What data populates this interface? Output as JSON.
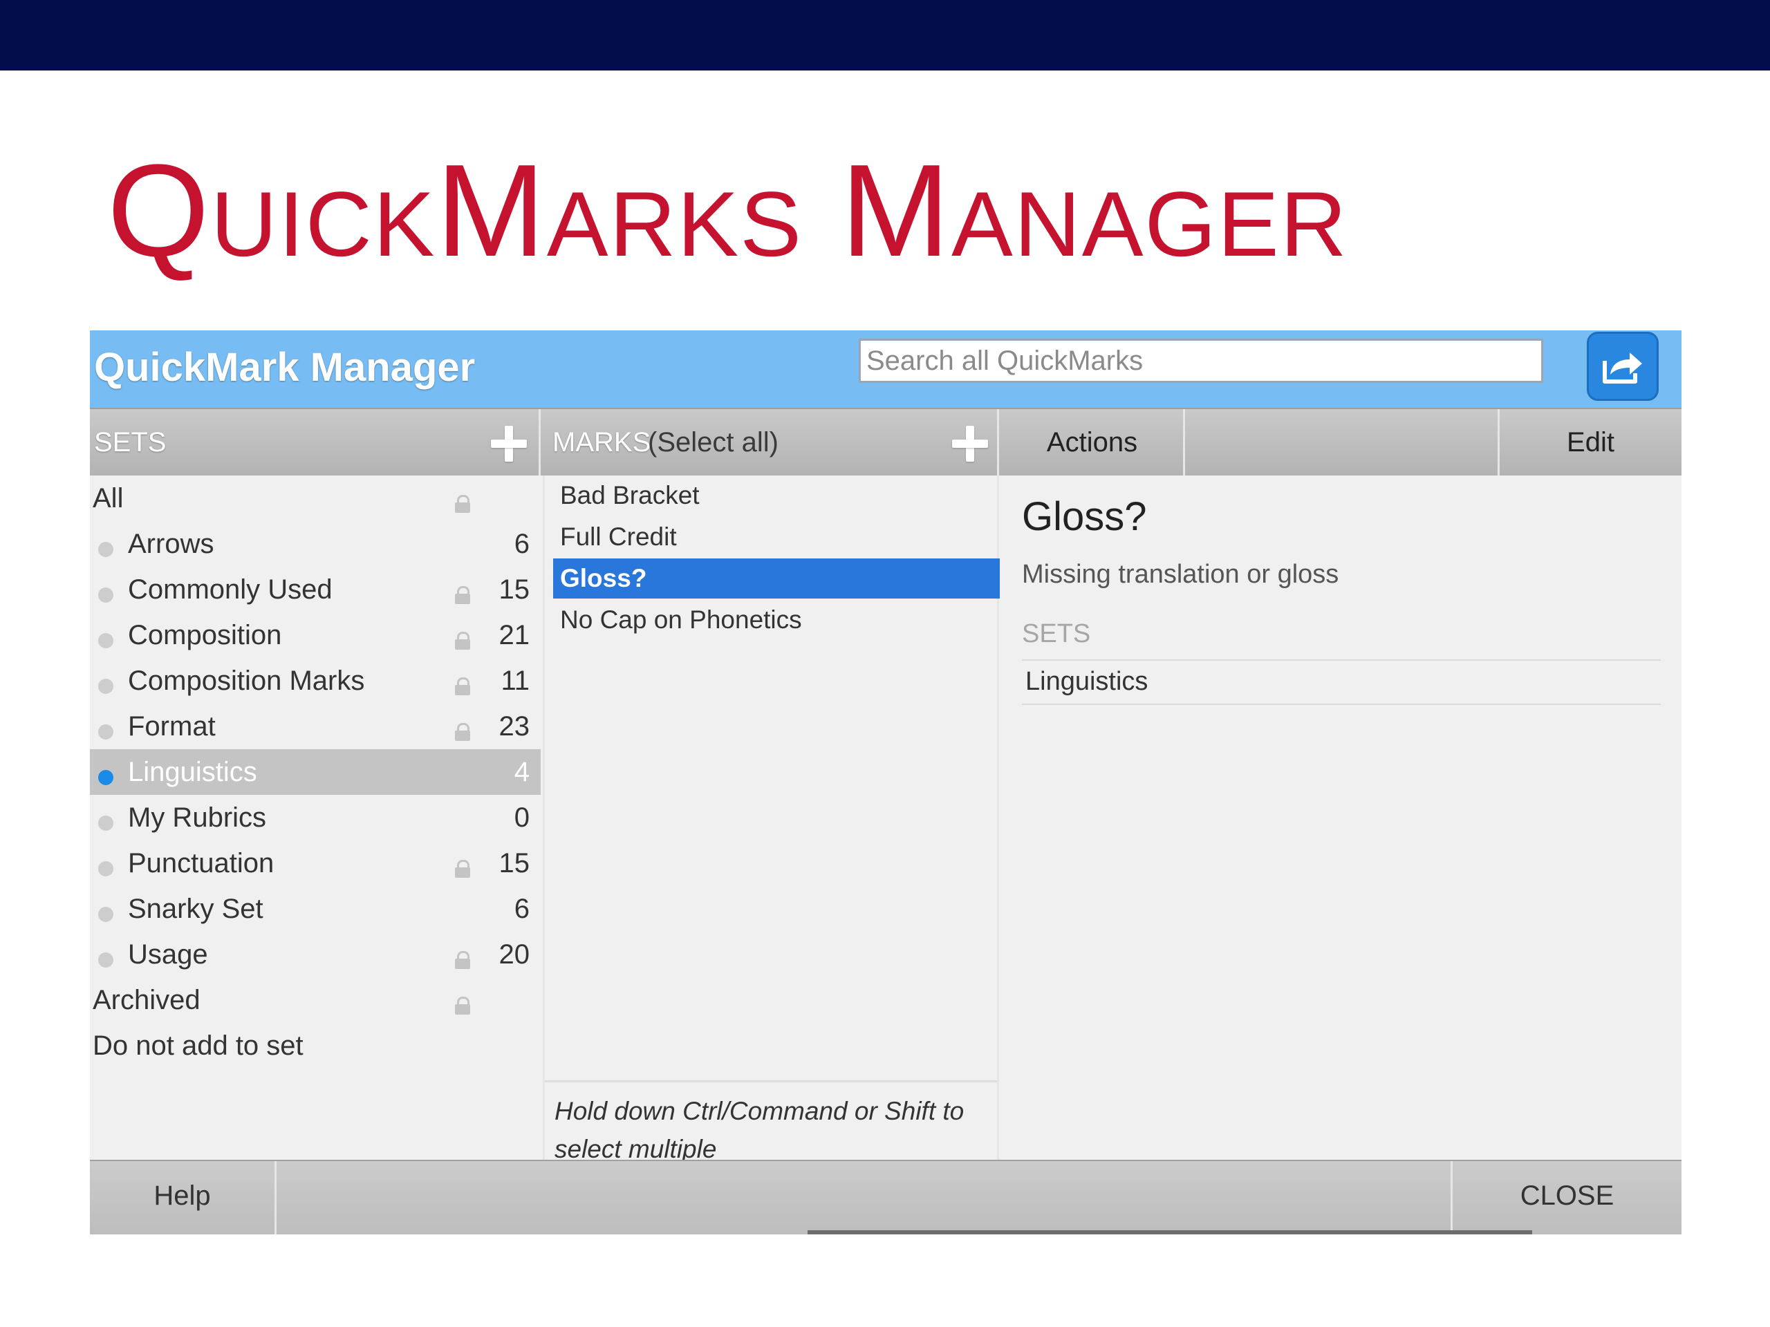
{
  "slide": {
    "title": "QuickMarks Manager"
  },
  "window": {
    "title": "QuickMark Manager",
    "search_placeholder": "Search all QuickMarks",
    "export_icon": "export-share-icon"
  },
  "headers": {
    "sets": "SETS",
    "marks": "MARKS",
    "select_all": "(Select all)",
    "actions": "Actions",
    "edit": "Edit"
  },
  "sets": [
    {
      "name": "All",
      "count": "",
      "locked": true,
      "dot": false,
      "selected": false
    },
    {
      "name": "Arrows",
      "count": "6",
      "locked": false,
      "dot": true,
      "selected": false
    },
    {
      "name": "Commonly Used",
      "count": "15",
      "locked": true,
      "dot": true,
      "selected": false
    },
    {
      "name": "Composition",
      "count": "21",
      "locked": true,
      "dot": true,
      "selected": false
    },
    {
      "name": "Composition Marks",
      "count": "11",
      "locked": true,
      "dot": true,
      "selected": false
    },
    {
      "name": "Format",
      "count": "23",
      "locked": true,
      "dot": true,
      "selected": false
    },
    {
      "name": "Linguistics",
      "count": "4",
      "locked": false,
      "dot": true,
      "selected": true
    },
    {
      "name": "My Rubrics",
      "count": "0",
      "locked": false,
      "dot": true,
      "selected": false
    },
    {
      "name": "Punctuation",
      "count": "15",
      "locked": true,
      "dot": true,
      "selected": false
    },
    {
      "name": "Snarky Set",
      "count": "6",
      "locked": false,
      "dot": true,
      "selected": false
    },
    {
      "name": "Usage",
      "count": "20",
      "locked": true,
      "dot": true,
      "selected": false
    },
    {
      "name": "Archived",
      "count": "",
      "locked": true,
      "dot": false,
      "selected": false
    },
    {
      "name": "Do not add to set",
      "count": "",
      "locked": false,
      "dot": false,
      "selected": false
    }
  ],
  "marks": {
    "items": [
      {
        "name": "Bad Bracket",
        "selected": false
      },
      {
        "name": "Full Credit",
        "selected": false
      },
      {
        "name": "Gloss?",
        "selected": true
      },
      {
        "name": "No Cap on Phonetics",
        "selected": false
      }
    ],
    "hint": "Hold down Ctrl/Command or Shift to select multiple"
  },
  "detail": {
    "title": "Gloss?",
    "description": "Missing translation or gloss",
    "sets_label": "SETS",
    "sets": [
      "Linguistics"
    ]
  },
  "footer": {
    "help": "Help",
    "close": "CLOSE"
  },
  "colors": {
    "top_bar": "#030d4b",
    "slide_title": "#c4122f",
    "window_header": "#77bcf2",
    "selection": "#2a77db",
    "set_dot_active": "#1a8ae8"
  }
}
